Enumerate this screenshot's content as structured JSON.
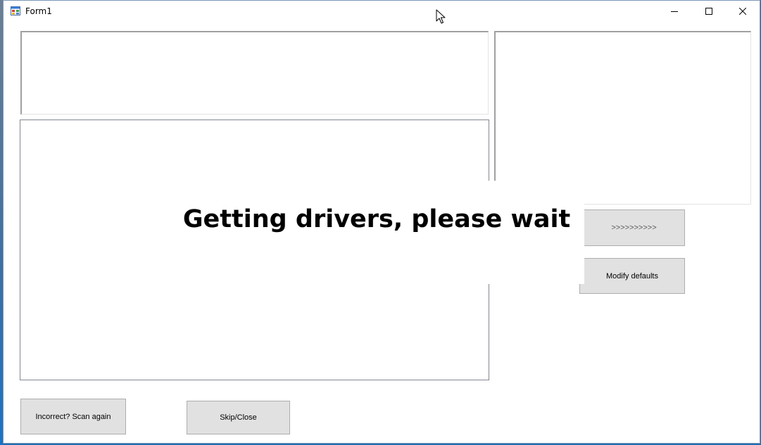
{
  "window": {
    "title": "Form1",
    "icon": "winforms-app-icon",
    "controls": [
      "minimize-icon",
      "maximize-icon",
      "close-icon"
    ]
  },
  "overlay": {
    "message": "Getting drivers, please wait"
  },
  "buttons": {
    "next_label": ">>>>>>>>>>",
    "modify_defaults_label": "Modify defaults",
    "scan_again_label": "Incorrect? Scan again",
    "skip_close_label": "Skip/Close"
  },
  "colors": {
    "button_face": "#e1e1e1",
    "button_border": "#adadad",
    "desktop": "#1f6fb3"
  }
}
